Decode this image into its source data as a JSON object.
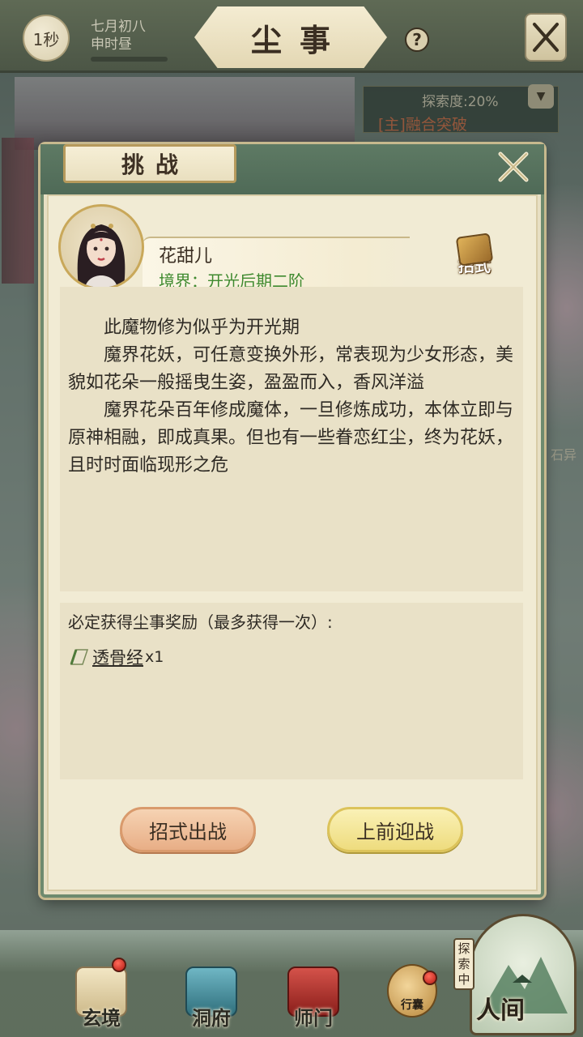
{
  "top_bar": {
    "timer": "1秒",
    "date": "七月初八",
    "period": "申时昼",
    "title": "尘事",
    "help_symbol": "?"
  },
  "exploration": {
    "progress_label": "探索度:20%",
    "quest": "[主]融合突破",
    "side_text": "石异"
  },
  "dialog": {
    "title": "挑战",
    "character": {
      "name": "花甜儿",
      "realm": "境界：开光后期二阶"
    },
    "moves_label": "招式",
    "description": [
      "此魔物修为似乎为开光期",
      "魔界花妖，可任意变换外形，常表现为少女形态，美貌如花朵一般摇曳生姿，盈盈而入，香风洋溢",
      "魔界花朵百年修成魔体，一旦修炼成功，本体立即与原神相融，即成真果。但也有一些眷恋红尘，终为花妖，且时时面临现形之危"
    ],
    "reward": {
      "title": "必定获得尘事奖励（最多获得一次）:",
      "item_name": "透骨经",
      "item_qty": "x1"
    },
    "buttons": {
      "moves_fight": "招式出战",
      "fight": "上前迎战"
    }
  },
  "bottom_nav": {
    "items": [
      {
        "label": "玄境"
      },
      {
        "label": "洞府"
      },
      {
        "label": "师门"
      }
    ],
    "bag_label": "行囊",
    "exploring_tag": "探索中",
    "world_label": "人间"
  },
  "colors": {
    "realm_green": "#3f8a2f",
    "quest_orange": "#e07a50",
    "frame_green": "#6e8a6e",
    "parchment": "#f1ebd4"
  }
}
